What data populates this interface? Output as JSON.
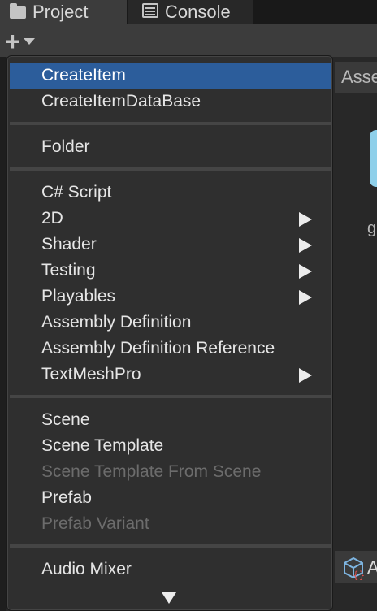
{
  "tabs": {
    "project": {
      "label": "Project",
      "icon": "folder-icon"
    },
    "console": {
      "label": "Console",
      "icon": "console-icon"
    }
  },
  "toolbar": {
    "create_button_icon": "plus-icon",
    "create_button_caret": "chevron-down-icon"
  },
  "background_panel": {
    "header_text": "Asse",
    "asset_label_text": "g",
    "bottom_bar_text": "A"
  },
  "menu": {
    "items": [
      {
        "label": "CreateItem",
        "selected": true,
        "disabled": false,
        "submenu": false
      },
      {
        "label": "CreateItemDataBase",
        "selected": false,
        "disabled": false,
        "submenu": false
      },
      {
        "label": "Folder",
        "selected": false,
        "disabled": false,
        "submenu": false
      },
      {
        "label": "C# Script",
        "selected": false,
        "disabled": false,
        "submenu": false
      },
      {
        "label": "2D",
        "selected": false,
        "disabled": false,
        "submenu": true
      },
      {
        "label": "Shader",
        "selected": false,
        "disabled": false,
        "submenu": true
      },
      {
        "label": "Testing",
        "selected": false,
        "disabled": false,
        "submenu": true
      },
      {
        "label": "Playables",
        "selected": false,
        "disabled": false,
        "submenu": true
      },
      {
        "label": "Assembly Definition",
        "selected": false,
        "disabled": false,
        "submenu": false
      },
      {
        "label": "Assembly Definition Reference",
        "selected": false,
        "disabled": false,
        "submenu": false
      },
      {
        "label": "TextMeshPro",
        "selected": false,
        "disabled": false,
        "submenu": true
      },
      {
        "label": "Scene",
        "selected": false,
        "disabled": false,
        "submenu": false
      },
      {
        "label": "Scene Template",
        "selected": false,
        "disabled": false,
        "submenu": false
      },
      {
        "label": "Scene Template From Scene",
        "selected": false,
        "disabled": true,
        "submenu": false
      },
      {
        "label": "Prefab",
        "selected": false,
        "disabled": false,
        "submenu": false
      },
      {
        "label": "Prefab Variant",
        "selected": false,
        "disabled": true,
        "submenu": false
      },
      {
        "label": "Audio Mixer",
        "selected": false,
        "disabled": false,
        "submenu": false
      }
    ],
    "scroll_indicator_icon": "scroll-down-arrow-icon"
  },
  "colors": {
    "selection": "#2c5d9b",
    "menu_background": "#2f2f2f",
    "disabled_text": "#6c6c6c"
  }
}
